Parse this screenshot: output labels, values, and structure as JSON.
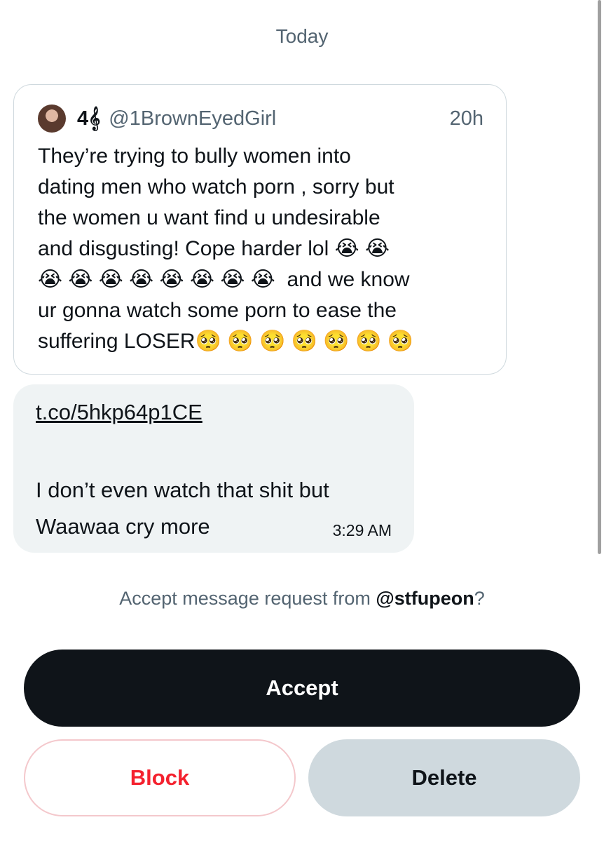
{
  "date_separator": "Today",
  "quoted_tweet": {
    "display_name": "4𝄞",
    "handle": "@1BrownEyedGirl",
    "time_ago": "20h",
    "text": "They’re trying to bully women into\ndating men who watch porn , sorry but\nthe women u want find u undesirable\nand disgusting! Cope harder lol 😭 😭\n😭 😭 😭 😭 😭 😭 😭 😭  and we know\nur gonna watch some porn to ease the\nsuffering LOSER🥺 🥺 🥺 🥺 🥺 🥺 🥺"
  },
  "message": {
    "link": "t.co/5hkp64p1CE",
    "text": "I don’t even watch that shit but\nWaawaa cry more",
    "time": "3:29 AM"
  },
  "request": {
    "prompt_prefix": "Accept message request from ",
    "username": "@stfupeon",
    "prompt_suffix": "?"
  },
  "buttons": {
    "accept": "Accept",
    "block": "Block",
    "delete": "Delete"
  }
}
